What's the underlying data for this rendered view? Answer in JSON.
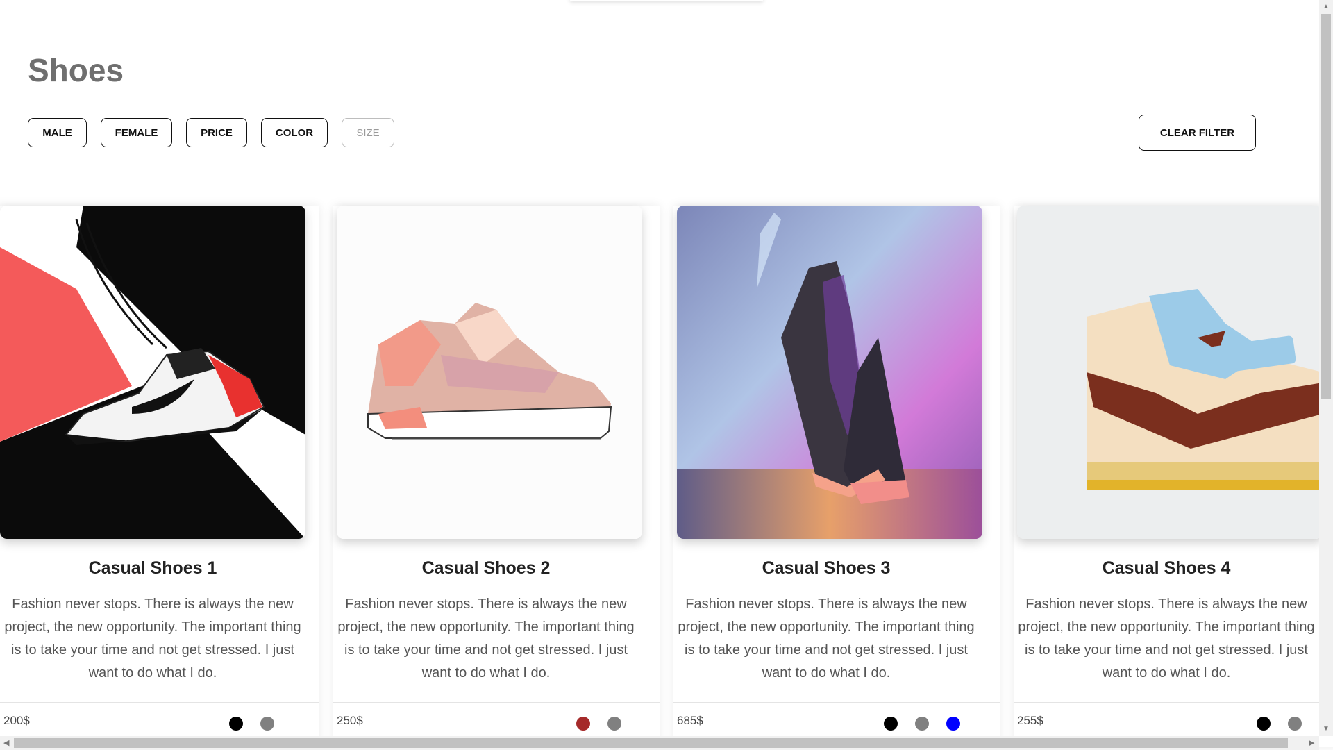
{
  "page_title": "Shoes",
  "filters": [
    "MALE",
    "FEMALE",
    "PRICE",
    "COLOR",
    "SIZE"
  ],
  "clear_filter_label": "CLEAR FILTER",
  "products": [
    {
      "name": "Casual Shoes 1",
      "description": "Fashion never stops. There is always the new project, the new opportunity. The important thing is to take your time and not get stressed. I just want to do what I do.",
      "price": "200$",
      "colors": [
        "#000000",
        "#808080"
      ]
    },
    {
      "name": "Casual Shoes 2",
      "description": "Fashion never stops. There is always the new project, the new opportunity. The important thing is to take your time and not get stressed. I just want to do what I do.",
      "price": "250$",
      "colors": [
        "#a52a2a",
        "#808080"
      ]
    },
    {
      "name": "Casual Shoes 3",
      "description": "Fashion never stops. There is always the new project, the new opportunity. The important thing is to take your time and not get stressed. I just want to do what I do.",
      "price": "685$",
      "colors": [
        "#000000",
        "#808080",
        "#0000ff"
      ]
    },
    {
      "name": "Casual Shoes 4",
      "description": "Fashion never stops. There is always the new project, the new opportunity. The important thing is to take your time and not get stressed. I just want to do what I do.",
      "price": "255$",
      "colors": [
        "#000000",
        "#808080"
      ]
    }
  ],
  "icons": {
    "scroll_left": "triangle-left",
    "scroll_right": "triangle-right",
    "scroll_up": "triangle-up",
    "scroll_down": "triangle-down"
  }
}
